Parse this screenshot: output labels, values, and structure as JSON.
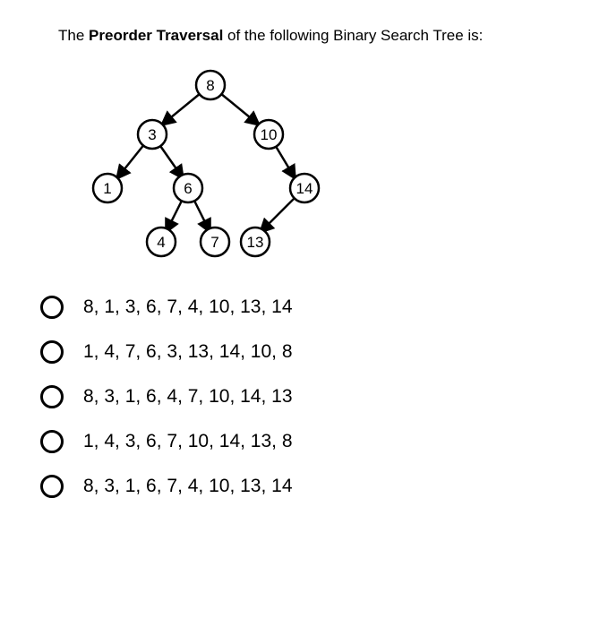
{
  "prompt": {
    "pre": "The ",
    "bold": "Preorder Traversal",
    "post": " of the following Binary Search Tree is:"
  },
  "tree": {
    "nodes": {
      "n8": "8",
      "n3": "3",
      "n10": "10",
      "n1": "1",
      "n6": "6",
      "n14": "14",
      "n4": "4",
      "n7": "7",
      "n13": "13"
    }
  },
  "options": [
    "8, 1, 3, 6, 7, 4, 10, 13, 14",
    "1, 4, 7, 6, 3, 13, 14, 10, 8",
    "8, 3, 1, 6, 4, 7, 10, 14, 13",
    "1, 4, 3, 6, 7, 10, 14, 13, 8",
    "8, 3, 1, 6, 7, 4, 10, 13, 14"
  ]
}
